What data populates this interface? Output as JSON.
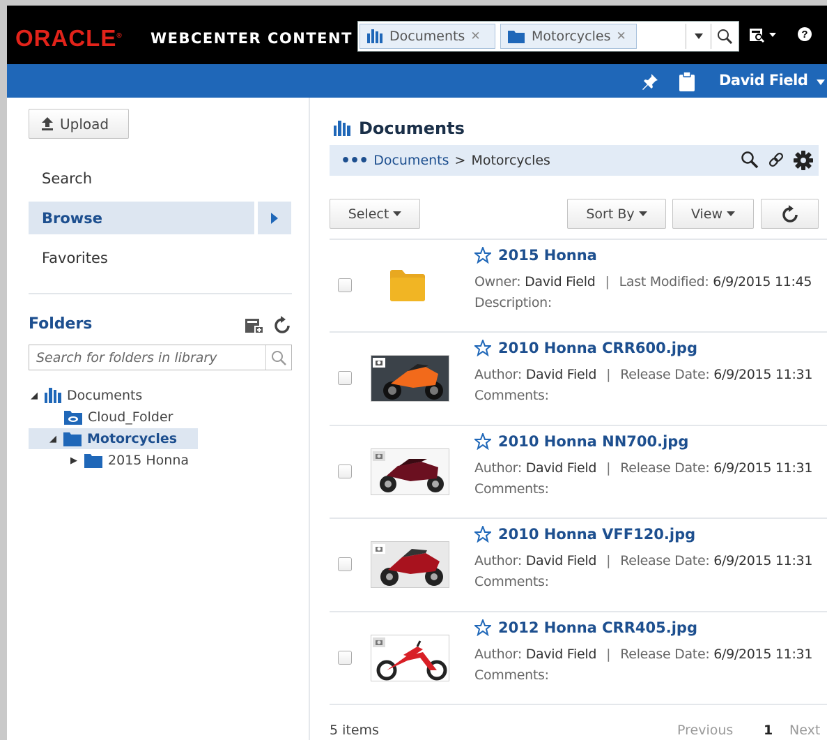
{
  "header": {
    "brand": "ORACLE",
    "product": "WEBCENTER CONTENT",
    "tabs": [
      {
        "label": "Documents"
      },
      {
        "label": "Motorcycles"
      }
    ]
  },
  "user": {
    "name": "David Field"
  },
  "left": {
    "upload_label": "Upload",
    "nav": [
      {
        "label": "Search"
      },
      {
        "label": "Browse"
      },
      {
        "label": "Favorites"
      }
    ],
    "folders_title": "Folders",
    "folder_search_placeholder": "Search for folders in library",
    "tree": [
      {
        "label": "Documents"
      },
      {
        "label": "Cloud_Folder"
      },
      {
        "label": "Motorcycles"
      },
      {
        "label": "2015 Honna"
      }
    ]
  },
  "main": {
    "title": "Documents",
    "breadcrumb": {
      "root": "Documents",
      "separator": ">",
      "current": "Motorcycles"
    },
    "buttons": {
      "select": "Select",
      "sort": "Sort By",
      "view": "View"
    },
    "items": [
      {
        "title": "2015 Honna",
        "k1": "Owner:",
        "v1": "David Field",
        "k2": "Last Modified:",
        "v2": "6/9/2015 11:45",
        "k3": "Description:"
      },
      {
        "title": "2010 Honna CRR600.jpg",
        "k1": "Author:",
        "v1": "David Field",
        "k2": "Release Date:",
        "v2": "6/9/2015 11:31",
        "k3": "Comments:"
      },
      {
        "title": "2010 Honna NN700.jpg",
        "k1": "Author:",
        "v1": "David Field",
        "k2": "Release Date:",
        "v2": "6/9/2015 11:31",
        "k3": "Comments:"
      },
      {
        "title": "2010 Honna VFF120.jpg",
        "k1": "Author:",
        "v1": "David Field",
        "k2": "Release Date:",
        "v2": "6/9/2015 11:31",
        "k3": "Comments:"
      },
      {
        "title": "2012 Honna CRR405.jpg",
        "k1": "Author:",
        "v1": "David Field",
        "k2": "Release Date:",
        "v2": "6/9/2015 11:31",
        "k3": "Comments:"
      }
    ],
    "footer": {
      "count": "5 items",
      "previous": "Previous",
      "page": "1",
      "next": "Next"
    }
  },
  "colors": {
    "brand_red": "#e2231a",
    "header_blue": "#1f67b8",
    "link_blue": "#1d4f8f",
    "folder_yellow": "#e8a820"
  }
}
